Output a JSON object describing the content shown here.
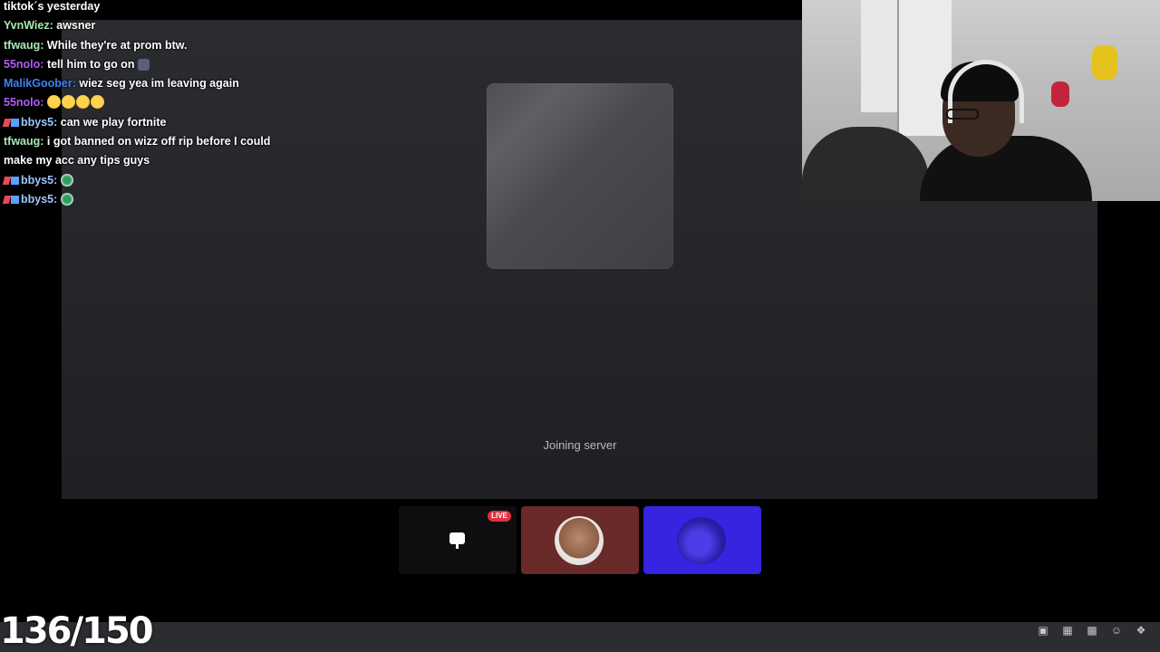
{
  "chat": [
    {
      "user": "",
      "color": "#ffffff",
      "text": "tiktok´s yesterday"
    },
    {
      "user": "YvnWiez:",
      "color": "#a7e8b4",
      "text": "awsner"
    },
    {
      "user": "tfwaug:",
      "color": "#a7e8b4",
      "text": "While they're at prom btw."
    },
    {
      "user": "55nolo:",
      "color": "#b05cf6",
      "text": "tell him to go on"
    },
    {
      "user": "MalikGoober:",
      "color": "#3b82f6",
      "text": "wiez seg yea im leaving again"
    },
    {
      "user": "55nolo:",
      "color": "#b05cf6",
      "text": ""
    },
    {
      "user": "bbys5:",
      "color": "#9ec5ff",
      "text": "can we play fortnite"
    },
    {
      "user": "tfwaug:",
      "color": "#a7e8b4",
      "text": "i got banned on wizz off rip before I could make my acc any tips guys"
    },
    {
      "user": "bbys5:",
      "color": "#9ec5ff",
      "text": ""
    },
    {
      "user": "bbys5:",
      "color": "#9ec5ff",
      "text": ""
    }
  ],
  "stage": {
    "status_text": "Joining server"
  },
  "tiles": {
    "live_badge": "LIVE"
  },
  "overlay": {
    "counter": "136/150"
  },
  "colors": {
    "stage_bg": "#26272a",
    "live_red": "#e0323e",
    "blue_tile": "#3524e0",
    "cam_tile": "#6a2a2a"
  },
  "icons": [
    "gift-icon",
    "gif-icon",
    "sticker-icon",
    "emoji-icon",
    "apps-icon"
  ]
}
